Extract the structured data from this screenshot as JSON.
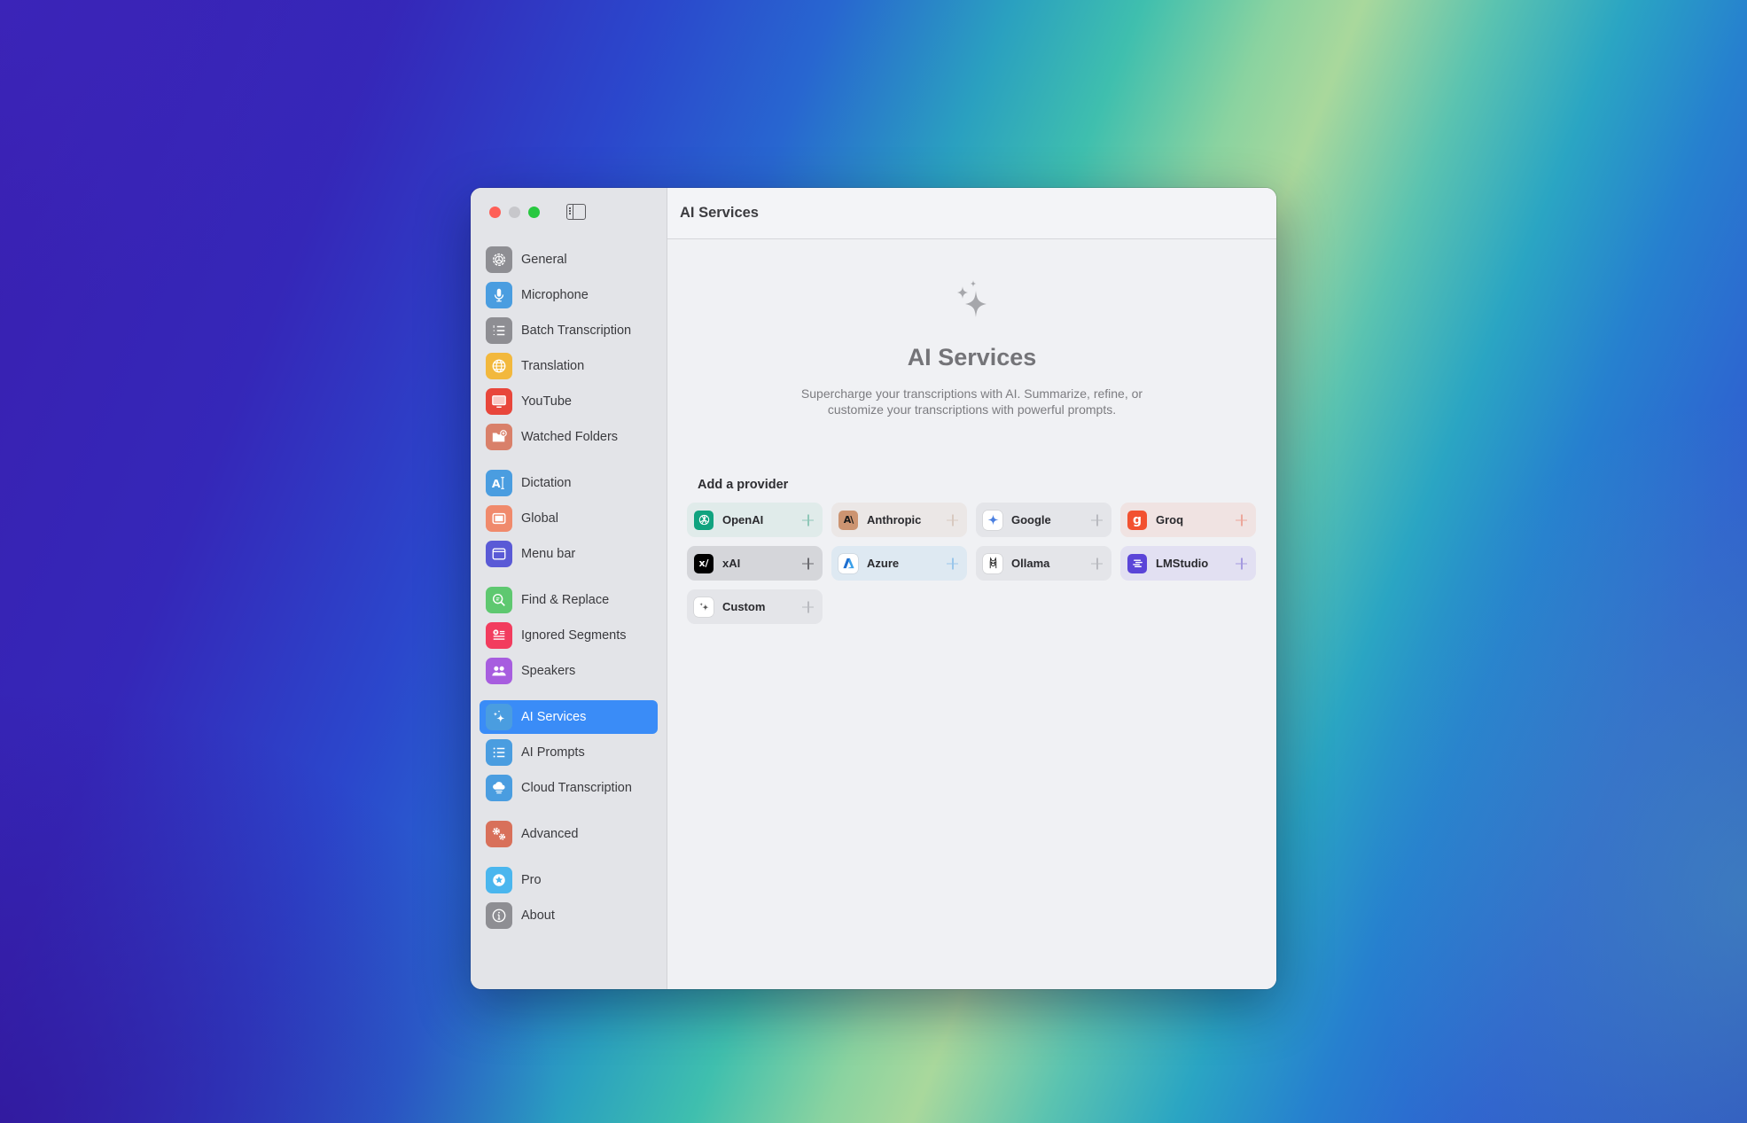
{
  "window": {
    "title": "AI Services",
    "traffic_lights": [
      "close",
      "minimize",
      "maximize"
    ]
  },
  "sidebar": {
    "toggle_icon": "sidebar-toggle-icon",
    "items": [
      {
        "label": "General",
        "icon": "gear-icon",
        "color": "#8e8e93",
        "group": 1
      },
      {
        "label": "Microphone",
        "icon": "microphone-icon",
        "color": "#4a9de0",
        "group": 1
      },
      {
        "label": "Batch Transcription",
        "icon": "numbered-list-icon",
        "color": "#8e8e93",
        "group": 1
      },
      {
        "label": "Translation",
        "icon": "globe-icon",
        "color": "#f2b83d",
        "group": 1
      },
      {
        "label": "YouTube",
        "icon": "tv-icon",
        "color": "#e8463b",
        "group": 1
      },
      {
        "label": "Watched Folders",
        "icon": "folder-add-icon",
        "color": "#d9806a",
        "group": 1
      },
      {
        "label": "Dictation",
        "icon": "text-cursor-icon",
        "color": "#4a9de0",
        "group": 2
      },
      {
        "label": "Global",
        "icon": "window-icon",
        "color": "#f08a6c",
        "group": 2
      },
      {
        "label": "Menu bar",
        "icon": "menubar-icon",
        "color": "#5a5ad6",
        "group": 2
      },
      {
        "label": "Find & Replace",
        "icon": "magnifier-icon",
        "color": "#5ec870",
        "group": 3
      },
      {
        "label": "Ignored Segments",
        "icon": "ignored-list-icon",
        "color": "#f23c5e",
        "group": 3
      },
      {
        "label": "Speakers",
        "icon": "people-icon",
        "color": "#a75ddf",
        "group": 3
      },
      {
        "label": "AI Services",
        "icon": "sparkles-icon",
        "color": "#4a9de0",
        "group": 4,
        "active": true
      },
      {
        "label": "AI Prompts",
        "icon": "list-icon",
        "color": "#4a9de0",
        "group": 4
      },
      {
        "label": "Cloud Transcription",
        "icon": "cloud-icon",
        "color": "#4a9de0",
        "group": 4
      },
      {
        "label": "Advanced",
        "icon": "gears-icon",
        "color": "#d8705a",
        "group": 5
      },
      {
        "label": "Pro",
        "icon": "star-badge-icon",
        "color": "#4ab6ee",
        "group": 6
      },
      {
        "label": "About",
        "icon": "info-icon",
        "color": "#8e8e93",
        "group": 6
      }
    ]
  },
  "main": {
    "header_title": "AI Services",
    "hero": {
      "icon": "sparkles-icon",
      "title": "AI Services",
      "description": "Supercharge your transcriptions with AI. Summarize, refine, or customize your transcriptions with powerful prompts."
    },
    "providers": {
      "title": "Add a provider",
      "items": [
        {
          "name": "OpenAI",
          "icon": "openai-logo-icon",
          "logo_bg": "#10a37f",
          "card_bg": "#e0ebea",
          "plus_color": "#8fc7b8"
        },
        {
          "name": "Anthropic",
          "icon": "anthropic-logo-icon",
          "logo_bg": "#cc9471",
          "card_bg": "#ebe7e6",
          "plus_color": "#d8c9c0"
        },
        {
          "name": "Google",
          "icon": "google-logo-icon",
          "logo_bg": "#ffffff",
          "card_bg": "#e4e5e9",
          "plus_color": "#b9bac0"
        },
        {
          "name": "Groq",
          "icon": "groq-logo-icon",
          "logo_bg": "#f25130",
          "card_bg": "#f0e3e2",
          "plus_color": "#eca79b"
        },
        {
          "name": "xAI",
          "icon": "xai-logo-icon",
          "logo_bg": "#000000",
          "card_bg": "#d5d6da",
          "plus_color": "#6b6b70"
        },
        {
          "name": "Azure",
          "icon": "azure-logo-icon",
          "logo_bg": "#ffffff",
          "card_bg": "#dee9f2",
          "plus_color": "#9ac6ea"
        },
        {
          "name": "Ollama",
          "icon": "ollama-logo-icon",
          "logo_bg": "#ffffff",
          "card_bg": "#e4e5e9",
          "plus_color": "#b9bac0"
        },
        {
          "name": "LMStudio",
          "icon": "lmstudio-logo-icon",
          "logo_bg": "#5b45d8",
          "card_bg": "#e2e0f2",
          "plus_color": "#a59ae0"
        },
        {
          "name": "Custom",
          "icon": "sparkles-icon",
          "logo_bg": "#ffffff",
          "card_bg": "#e4e5e9",
          "plus_color": "#b9bac0"
        }
      ]
    }
  }
}
